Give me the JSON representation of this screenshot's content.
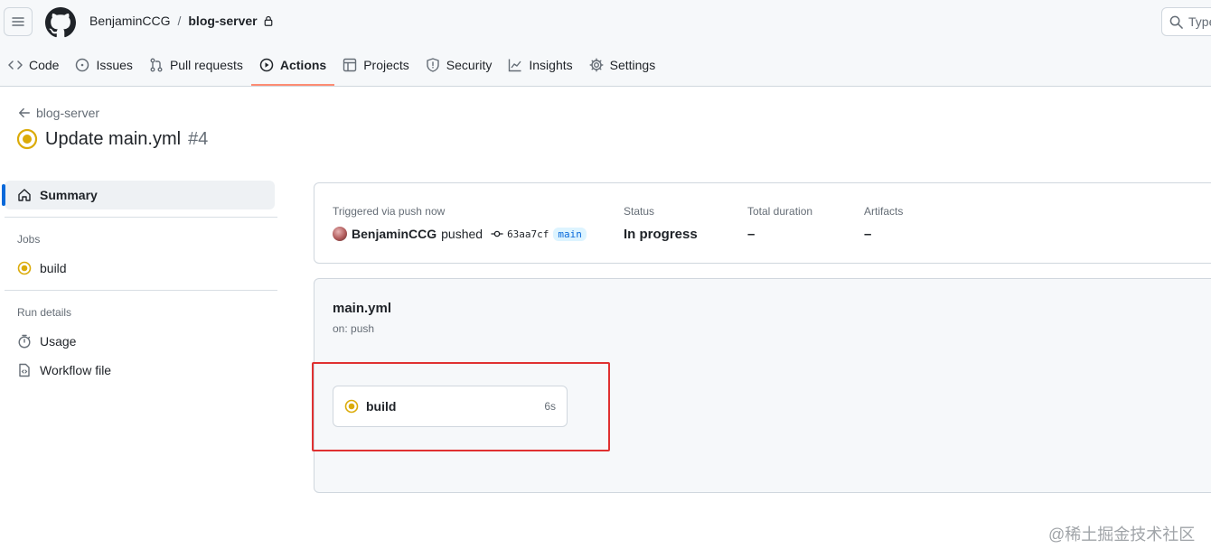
{
  "header": {
    "owner": "BenjaminCCG",
    "separator": "/",
    "repo": "blog-server",
    "search_placeholder": "Type"
  },
  "tabs": [
    {
      "label": "Code",
      "icon": "code-icon"
    },
    {
      "label": "Issues",
      "icon": "issue-icon"
    },
    {
      "label": "Pull requests",
      "icon": "pull-request-icon"
    },
    {
      "label": "Actions",
      "icon": "play-icon",
      "active": true
    },
    {
      "label": "Projects",
      "icon": "table-icon"
    },
    {
      "label": "Security",
      "icon": "shield-icon"
    },
    {
      "label": "Insights",
      "icon": "graph-icon"
    },
    {
      "label": "Settings",
      "icon": "gear-icon"
    }
  ],
  "run": {
    "back_label": "blog-server",
    "title": "Update main.yml",
    "number": "#4"
  },
  "sidebar": {
    "summary_label": "Summary",
    "jobs_heading": "Jobs",
    "job_label": "build",
    "run_details_heading": "Run details",
    "usage_label": "Usage",
    "workflow_file_label": "Workflow file"
  },
  "summary": {
    "trigger_label": "Triggered via push now",
    "actor": "BenjaminCCG",
    "action": "pushed",
    "commit": "63aa7cf",
    "branch": "main",
    "status_label": "Status",
    "status_value": "In progress",
    "duration_label": "Total duration",
    "duration_value": "–",
    "artifacts_label": "Artifacts",
    "artifacts_value": "–"
  },
  "workflow": {
    "file": "main.yml",
    "trigger": "on: push",
    "job_name": "build",
    "job_time": "6s"
  },
  "watermark": "@稀土掘金技术社区",
  "colors": {
    "in_progress": "#dbab09",
    "accent": "#0969da",
    "tab_underline": "#fd8c73",
    "highlight": "#e03131"
  }
}
